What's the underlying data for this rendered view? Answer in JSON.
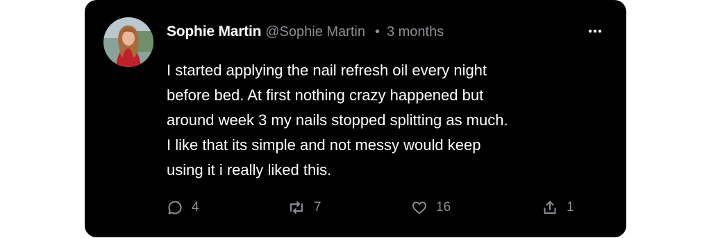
{
  "post": {
    "author_name": "Sophie Martin",
    "author_handle": "@Sophie Martin",
    "separator": "•",
    "timestamp": "3 months",
    "text": "I started applying the nail refresh oil every night\nbefore bed. At first nothing crazy happened but\naround week 3 my nails stopped splitting as much.\nI like that its simple and not messy would keep\nusing it i really liked this."
  },
  "actions": {
    "replies": "4",
    "reposts": "7",
    "likes": "16",
    "shares": "1"
  },
  "icons": {
    "reply": "speech-bubble-icon",
    "repost": "repost-arrows-icon",
    "like": "heart-icon",
    "share": "share-upload-icon",
    "more": "ellipsis-icon"
  },
  "colors": {
    "card_background": "#000000",
    "page_background": "#ffffff",
    "primary_text": "#ffffff",
    "secondary_text": "#8b8f94"
  }
}
